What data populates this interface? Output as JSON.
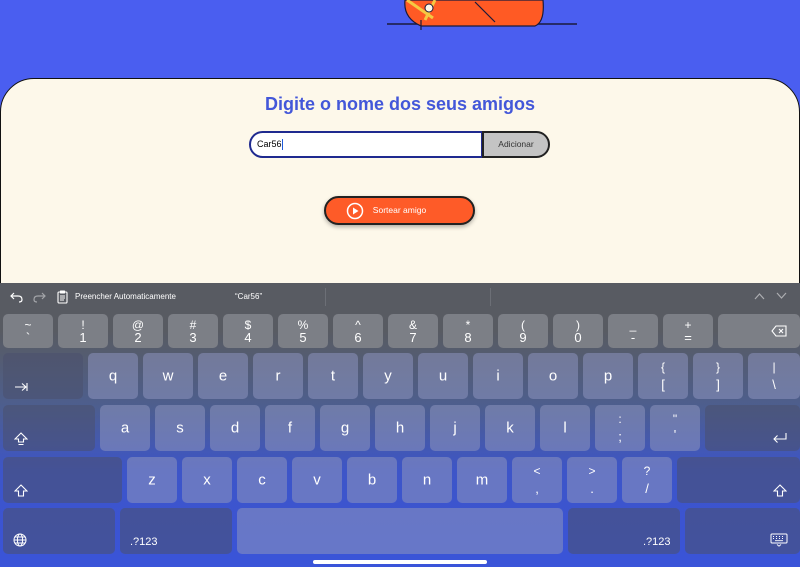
{
  "page": {
    "title": "Digite o nome dos seus amigos",
    "input_value": "Car56",
    "add_label": "Adicionar",
    "draw_label": "Sortear amigo"
  },
  "keyboard_bar": {
    "autofill_label": "Preencher Automaticamente",
    "suggestion": "“Car56”"
  },
  "keyboard": {
    "number_row": [
      {
        "top": "~",
        "bot": "`"
      },
      {
        "top": "!",
        "bot": "1"
      },
      {
        "top": "@",
        "bot": "2"
      },
      {
        "top": "#",
        "bot": "3"
      },
      {
        "top": "$",
        "bot": "4"
      },
      {
        "top": "%",
        "bot": "5"
      },
      {
        "top": "^",
        "bot": "6"
      },
      {
        "top": "&",
        "bot": "7"
      },
      {
        "top": "*",
        "bot": "8"
      },
      {
        "top": "(",
        "bot": "9"
      },
      {
        "top": ")",
        "bot": "0"
      },
      {
        "top": "_",
        "bot": "-"
      },
      {
        "top": "+",
        "bot": "="
      }
    ],
    "row1": [
      "q",
      "w",
      "e",
      "r",
      "t",
      "y",
      "u",
      "i",
      "o",
      "p"
    ],
    "row1_symbols": [
      {
        "top": "{",
        "bot": "["
      },
      {
        "top": "}",
        "bot": "]"
      },
      {
        "top": "|",
        "bot": "\\"
      }
    ],
    "row2": [
      "a",
      "s",
      "d",
      "f",
      "g",
      "h",
      "j",
      "k",
      "l"
    ],
    "row2_symbols": [
      {
        "top": ":",
        "bot": ";"
      },
      {
        "top": "\"",
        "bot": "'"
      }
    ],
    "row3": [
      "z",
      "x",
      "c",
      "v",
      "b",
      "n",
      "m"
    ],
    "row3_symbols": [
      {
        "top": "<",
        "bot": ","
      },
      {
        "top": ">",
        "bot": "."
      },
      {
        "top": "?",
        "bot": "/"
      }
    ],
    "numbers_key_label": ".?123"
  },
  "colors": {
    "background": "#4a5ef0",
    "card": "#fdf8ea",
    "title": "#4357d9",
    "accent": "#fe5b28",
    "add_button": "#c4c4c4"
  },
  "icons": [
    "undo-icon",
    "redo-icon",
    "clipboard-icon",
    "chevron-up-icon",
    "chevron-down-icon",
    "play-icon",
    "delete-icon",
    "tab-icon",
    "caps-lock-icon",
    "return-icon",
    "shift-icon",
    "globe-icon",
    "keyboard-dismiss-icon"
  ]
}
